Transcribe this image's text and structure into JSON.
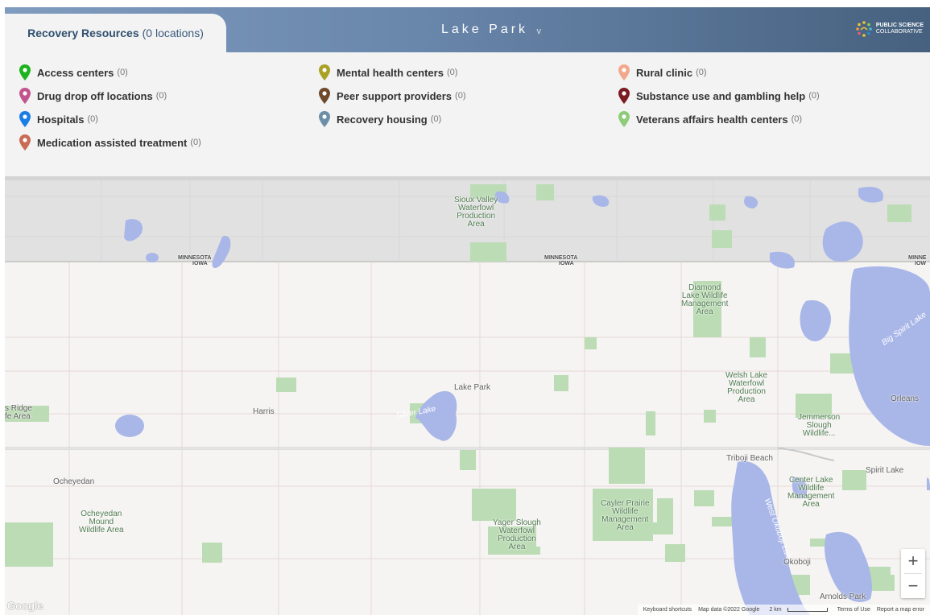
{
  "header": {
    "tab_title": "Recovery Resources",
    "tab_count": "(0 locations)",
    "location": "Lake Park",
    "location_chevron": "v",
    "logo_line1": "PUBLIC SCIENCE",
    "logo_line2": "COLLABORATIVE",
    "logo_icon": "starburst-logo-icon"
  },
  "legend": {
    "items": [
      {
        "label": "Access centers",
        "count": "(0)",
        "color": "#1db31d"
      },
      {
        "label": "Drug drop off locations",
        "count": "(0)",
        "color": "#c2548f"
      },
      {
        "label": "Hospitals",
        "count": "(0)",
        "color": "#1b7ee6"
      },
      {
        "label": "Medication assisted treatment",
        "count": "(0)",
        "color": "#c96b55"
      },
      {
        "label": "Mental health centers",
        "count": "(0)",
        "color": "#a9a224"
      },
      {
        "label": "Peer support providers",
        "count": "(0)",
        "color": "#6e4a2b"
      },
      {
        "label": "Recovery housing",
        "count": "(0)",
        "color": "#6b8fa8"
      },
      {
        "label": "Rural clinic",
        "count": "(0)",
        "color": "#f2a88c"
      },
      {
        "label": "Substance use and gambling help",
        "count": "(0)",
        "color": "#7a1c22"
      },
      {
        "label": "Veterans affairs health centers",
        "count": "(0)",
        "color": "#8fcc7a"
      }
    ]
  },
  "map": {
    "labels": {
      "sioux_valley": "Sioux Valley\nWaterfowl\nProduction\nArea",
      "mn1": "MINNESOTA",
      "ia1": "IOWA",
      "mn2": "MINNESOTA",
      "ia2": "IOWA",
      "mn3": "MINNE",
      "ia3": "IOW",
      "diamond_lake": "Diamond\nLake Wildlife\nManagement\nArea",
      "big_spirit_lake": "Big Spirit Lake",
      "lake_park": "Lake Park",
      "welsh_lake": "Welsh Lake\nWaterfowl\nProduction\nArea",
      "orleans": "Orleans",
      "ridge": "s Ridge\nfe Area",
      "harris": "Harris",
      "silver_lake": "Silver Lake",
      "jemmerson": "Jemmerson\nSlough\nWildlife...",
      "triboji": "Triboji Beach",
      "spirit_lake": "Spirit Lake",
      "ocheyedan": "Ocheyedan",
      "center_lake": "Center Lake\nWildlife\nManagement\nArea",
      "ocheyedan_mound": "Ocheyedan\nMound\nWildlife Area",
      "cayler": "Cayler Prairie\nWildlife\nManagement\nArea",
      "yager": "Yager Slough\nWaterfowl\nProduction\nArea",
      "west_okoboji": "West Okoboji Lake",
      "okoboji": "Okoboji",
      "arnolds_park": "Arnolds Park"
    },
    "zoom_in": "+",
    "zoom_out": "−",
    "google_logo": "Google",
    "attribution": {
      "shortcuts": "Keyboard shortcuts",
      "map_data": "Map data ©2022 Google",
      "scale": "2 km",
      "terms": "Terms of Use",
      "report": "Report a map error"
    }
  }
}
